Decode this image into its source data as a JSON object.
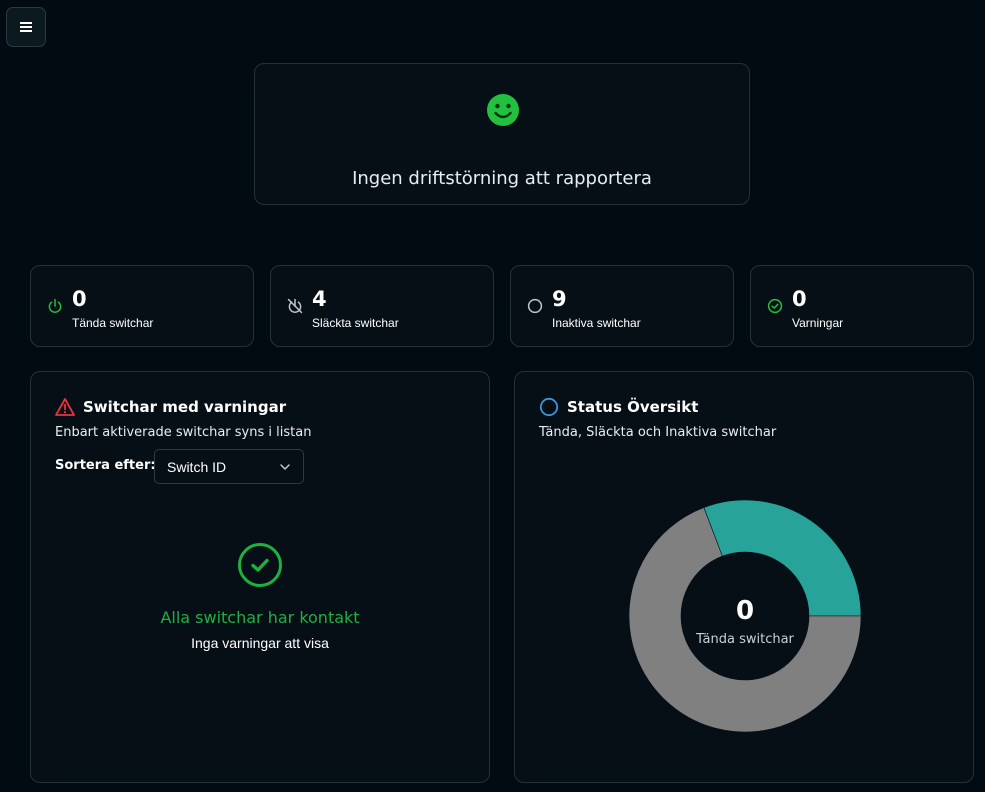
{
  "menu": {
    "icon": "hamburger-icon"
  },
  "status": {
    "icon": "smiley-icon",
    "message": "Ingen driftstörning att rapportera",
    "color": "#22c03f"
  },
  "stats": [
    {
      "icon": "power-icon",
      "value": "0",
      "label": "Tända switchar",
      "color": "#22c03f"
    },
    {
      "icon": "power-off-icon",
      "value": "4",
      "label": "Släckta switchar",
      "color": "#bfc6cb"
    },
    {
      "icon": "circle-icon",
      "value": "9",
      "label": "Inaktiva switchar",
      "color": "#bfc6cb"
    },
    {
      "icon": "check-circle-icon",
      "value": "0",
      "label": "Varningar",
      "color": "#22c03f"
    }
  ],
  "warnings_panel": {
    "icon": "warning-triangle-icon",
    "title": "Switchar med varningar",
    "subtitle": "Enbart aktiverade switchar syns i listan",
    "sort_label": "Sortera efter:",
    "sort_value": "Switch ID",
    "empty_icon": "check-circle-icon",
    "empty_title": "Alla switchar har kontakt",
    "empty_subtitle": "Inga varningar att visa"
  },
  "overview_panel": {
    "icon": "circle-outline-icon",
    "title": "Status Översikt",
    "subtitle": "Tända, Släckta och Inaktiva switchar",
    "center_value": "0",
    "center_label": "Tända switchar"
  },
  "chart_data": {
    "type": "pie",
    "categories": [
      "Tända switchar",
      "Släckta switchar",
      "Inaktiva switchar"
    ],
    "values": [
      0,
      4,
      9
    ],
    "colors": [
      "#22c03f",
      "#27a39a",
      "#808080"
    ]
  }
}
